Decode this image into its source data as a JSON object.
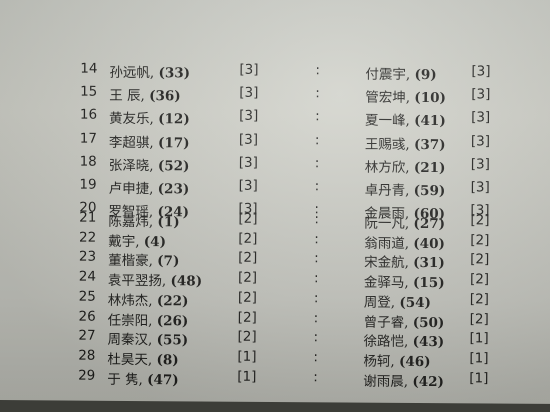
{
  "rows": [
    {
      "num": "14",
      "left_name": "孙远帆,",
      "left_points": "(33)",
      "left_round": "[3]",
      "sep": ":",
      "right_name": "付震宇,",
      "right_points": "(9)",
      "right_round": "[3]"
    },
    {
      "num": "15",
      "left_name": "王 辰,",
      "left_points": "(36)",
      "left_round": "[3]",
      "sep": ":",
      "right_name": "管宏坤,",
      "right_points": "(10)",
      "right_round": "[3]"
    },
    {
      "num": "16",
      "left_name": "黄友乐,",
      "left_points": "(12)",
      "left_round": "[3]",
      "sep": ":",
      "right_name": "夏一峰,",
      "right_points": "(41)",
      "right_round": "[3]"
    },
    {
      "num": "17",
      "left_name": "李超骐,",
      "left_points": "(17)",
      "left_round": "[3]",
      "sep": ":",
      "right_name": "王赐彧,",
      "right_points": "(37)",
      "right_round": "[3]"
    },
    {
      "num": "18",
      "left_name": "张泽晓,",
      "left_points": "(52)",
      "left_round": "[3]",
      "sep": ":",
      "right_name": "林方欣,",
      "right_points": "(21)",
      "right_round": "[3]"
    },
    {
      "num": "19",
      "left_name": "卢申捷,",
      "left_points": "(23)",
      "left_round": "[3]",
      "sep": ":",
      "right_name": "卓丹青,",
      "right_points": "(59)",
      "right_round": "[3]"
    },
    {
      "num": "20",
      "left_name": "罗智瑶,",
      "left_points": "(24)",
      "left_round": "[3]",
      "sep": ":",
      "right_name": "金晨雨,",
      "right_points": "(60)",
      "right_round": "[3]"
    },
    {
      "num": "21",
      "left_name": "陈嘉炜,",
      "left_points": "(1)",
      "left_round": "[2]",
      "sep": ":",
      "right_name": "阮一凡,",
      "right_points": "(27)",
      "right_round": "[2]"
    },
    {
      "num": "22",
      "left_name": "戴宇,",
      "left_points": "(4)",
      "left_round": "[2]",
      "sep": ":",
      "right_name": "翁雨道,",
      "right_points": "(40)",
      "right_round": "[2]"
    },
    {
      "num": "23",
      "left_name": "董楷豪,",
      "left_points": "(7)",
      "left_round": "[2]",
      "sep": ":",
      "right_name": "宋金航,",
      "right_points": "(31)",
      "right_round": "[2]"
    },
    {
      "num": "24",
      "left_name": "袁平翌扬,",
      "left_points": "(48)",
      "left_round": "[2]",
      "sep": ":",
      "right_name": "金驿马,",
      "right_points": "(15)",
      "right_round": "[2]"
    },
    {
      "num": "25",
      "left_name": "林炜杰,",
      "left_points": "(22)",
      "left_round": "[2]",
      "sep": ":",
      "right_name": "周登,",
      "right_points": "(54)",
      "right_round": "[2]"
    },
    {
      "num": "26",
      "left_name": "任崇阳,",
      "left_points": "(26)",
      "left_round": "[2]",
      "sep": ":",
      "right_name": "曾子睿,",
      "right_points": "(50)",
      "right_round": "[2]"
    },
    {
      "num": "27",
      "left_name": "周秦汉,",
      "left_points": "(55)",
      "left_round": "[2]",
      "sep": ":",
      "right_name": "徐路恺,",
      "right_points": "(43)",
      "right_round": "[1]"
    },
    {
      "num": "28",
      "left_name": "杜昊天,",
      "left_points": "(8)",
      "left_round": "[1]",
      "sep": ":",
      "right_name": "杨轲,",
      "right_points": "(46)",
      "right_round": "[1]"
    },
    {
      "num": "29",
      "left_name": "于 隽,",
      "left_points": "(47)",
      "left_round": "[1]",
      "sep": ":",
      "right_name": "谢雨晨,",
      "right_points": "(42)",
      "right_round": "[1]"
    }
  ]
}
